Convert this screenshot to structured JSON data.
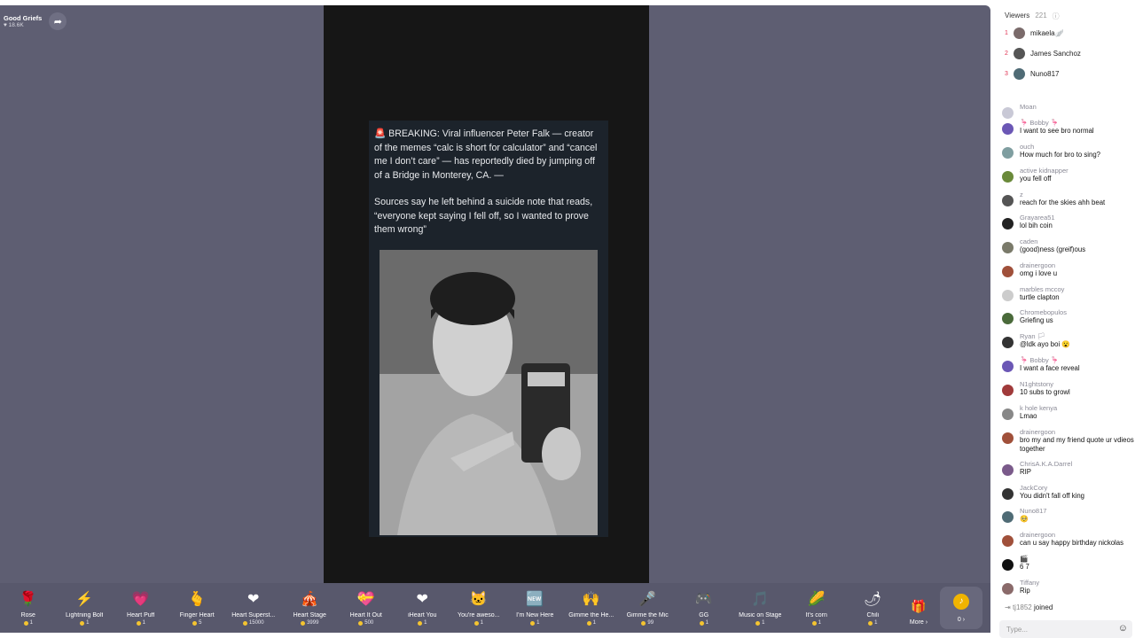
{
  "host": {
    "name": "Good Griefs",
    "likes": "18.6K",
    "share_icon": "share-icon"
  },
  "post": {
    "paragraph1": "🚨 BREAKING: Viral influencer Peter Falk — creator of the memes “calc is short for calculator” and “cancel me I don’t care” — has reportedly died by jumping off of a Bridge in Monterey, CA. —",
    "paragraph2": "Sources say he left behind a suicide note that reads, “everyone kept saying I fell off, so I wanted to prove them wrong”"
  },
  "gifts": [
    {
      "name": "Rose",
      "price": "1",
      "icon": "🌹"
    },
    {
      "name": "Lightning Bolt",
      "price": "1",
      "icon": "⚡"
    },
    {
      "name": "Heart Puff",
      "price": "1",
      "icon": "💗"
    },
    {
      "name": "Finger Heart",
      "price": "5",
      "icon": "🫰"
    },
    {
      "name": "Heart Superst...",
      "price": "15000",
      "icon": "❤"
    },
    {
      "name": "Heart Stage",
      "price": "3999",
      "icon": "🎪"
    },
    {
      "name": "Heart It Out",
      "price": "500",
      "icon": "💝"
    },
    {
      "name": "iHeart You",
      "price": "1",
      "icon": "❤"
    },
    {
      "name": "You're aweso...",
      "price": "1",
      "icon": "🐱"
    },
    {
      "name": "I'm New Here",
      "price": "1",
      "icon": "🆕"
    },
    {
      "name": "Gimme the He...",
      "price": "1",
      "icon": "🙌"
    },
    {
      "name": "Gimme the Mic",
      "price": "99",
      "icon": "🎤"
    },
    {
      "name": "GG",
      "price": "1",
      "icon": "🎮"
    },
    {
      "name": "Music on Stage",
      "price": "1",
      "icon": "🎵"
    },
    {
      "name": "It's corn",
      "price": "1",
      "icon": "🌽"
    },
    {
      "name": "Chili",
      "price": "1",
      "icon": "🌶"
    }
  ],
  "more_label": "More ›",
  "coins": {
    "value": "0 ›"
  },
  "viewers": {
    "label": "Viewers",
    "count": "221"
  },
  "top_viewers": [
    {
      "rank": "1",
      "name": "mikaela🪽",
      "color": "#7a6a6a"
    },
    {
      "rank": "2",
      "name": "James Sanchoz",
      "color": "#555"
    },
    {
      "rank": "3",
      "name": "Nuno817",
      "color": "#4f6b75"
    }
  ],
  "chat": [
    {
      "user": "Moan",
      "text": "",
      "color": "#c9c9d6"
    },
    {
      "user": "🦩 Bobby 🦩",
      "text": "I want to see bro normal",
      "color": "#6b57b5"
    },
    {
      "user": "ouch",
      "text": "How much for bro to sing?",
      "color": "#7f9ea0"
    },
    {
      "user": "active kidnapper",
      "text": "you fell off",
      "color": "#6a8a3a"
    },
    {
      "user": "z",
      "text": "reach for the skies ahh beat",
      "color": "#555"
    },
    {
      "user": "Grayarea51",
      "text": "lol bih coin",
      "color": "#222"
    },
    {
      "user": "caden",
      "text": "(good)ness (greif)ous",
      "color": "#7a7a6a"
    },
    {
      "user": "drainergoon",
      "text": "omg i love u",
      "color": "#a0503a"
    },
    {
      "user": "marbles mccoy",
      "text": "turtle clapton",
      "color": "#ccc"
    },
    {
      "user": "Chromebopulos",
      "text": "Griefing us",
      "color": "#4a6a3a"
    },
    {
      "user": "Ryan 🏳",
      "text": "@ldk ayo boi 😮",
      "color": "#333"
    },
    {
      "user": "🦩 Bobby 🦩",
      "text": "I want a face reveal",
      "color": "#6b57b5"
    },
    {
      "user": "N1ghtstony",
      "text": "10 subs to growl",
      "color": "#a03a3a"
    },
    {
      "user": "k hole kenya",
      "text": "Lmao",
      "color": "#888"
    },
    {
      "user": "drainergoon",
      "text": "bro my and my friend quote ur vdieos together",
      "color": "#a0503a"
    },
    {
      "user": "ChrisA.K.A.Darrel",
      "text": "RIP",
      "color": "#7a5a8a"
    },
    {
      "user": "JackCory",
      "text": "You didn't fall off king",
      "color": "#333"
    },
    {
      "user": "Nuno817",
      "text": "🥺",
      "color": "#4f6b75"
    },
    {
      "user": "drainergoon",
      "text": "can u say happy birthday nickolas",
      "color": "#a0503a"
    },
    {
      "user": "🎬",
      "text": "6 7",
      "color": "#111"
    },
    {
      "user": "Tiffany",
      "text": "Rip",
      "color": "#8a6a6a"
    }
  ],
  "joined": {
    "user": "tj1852",
    "text": "joined"
  },
  "input": {
    "placeholder": "Type..."
  }
}
